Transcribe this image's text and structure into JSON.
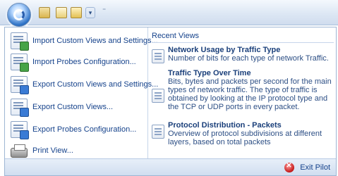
{
  "quick_access": {
    "buttons": [
      {
        "icon": "folder-save-icon"
      },
      {
        "icon": "document-icon"
      },
      {
        "icon": "document-dropdown-icon"
      },
      {
        "icon": "chevron-down-icon"
      }
    ],
    "separator_glyph": "⁼"
  },
  "menu": {
    "items": [
      {
        "label": "Import Custom Views and Settings...",
        "icon": "import-views-icon"
      },
      {
        "label": "Import Probes Configuration...",
        "icon": "import-probes-icon"
      },
      {
        "label": "Export Custom Views and Settings...",
        "icon": "export-views-icon"
      },
      {
        "label": "Export Custom Views...",
        "icon": "export-custom-views-icon"
      },
      {
        "label": "Export Probes Configuration...",
        "icon": "export-probes-icon"
      },
      {
        "label": "Print View...",
        "icon": "printer-icon"
      }
    ]
  },
  "recent": {
    "title": "Recent Views",
    "items": [
      {
        "title": "Network Usage by Traffic Type",
        "description": "Number of bits for each type of network Traffic."
      },
      {
        "title": "Traffic Type Over Time",
        "description": "Bits, bytes and packets per second for the main types of network traffic. The type of traffic is obtained by looking at the IP protocol type and the TCP or UDP ports in every packet."
      },
      {
        "title": "Protocol Distribution - Packets",
        "description": "Overview of protocol subdivisions at different layers, based on total packets"
      }
    ]
  },
  "footer": {
    "exit_label": "Exit Pilot"
  }
}
